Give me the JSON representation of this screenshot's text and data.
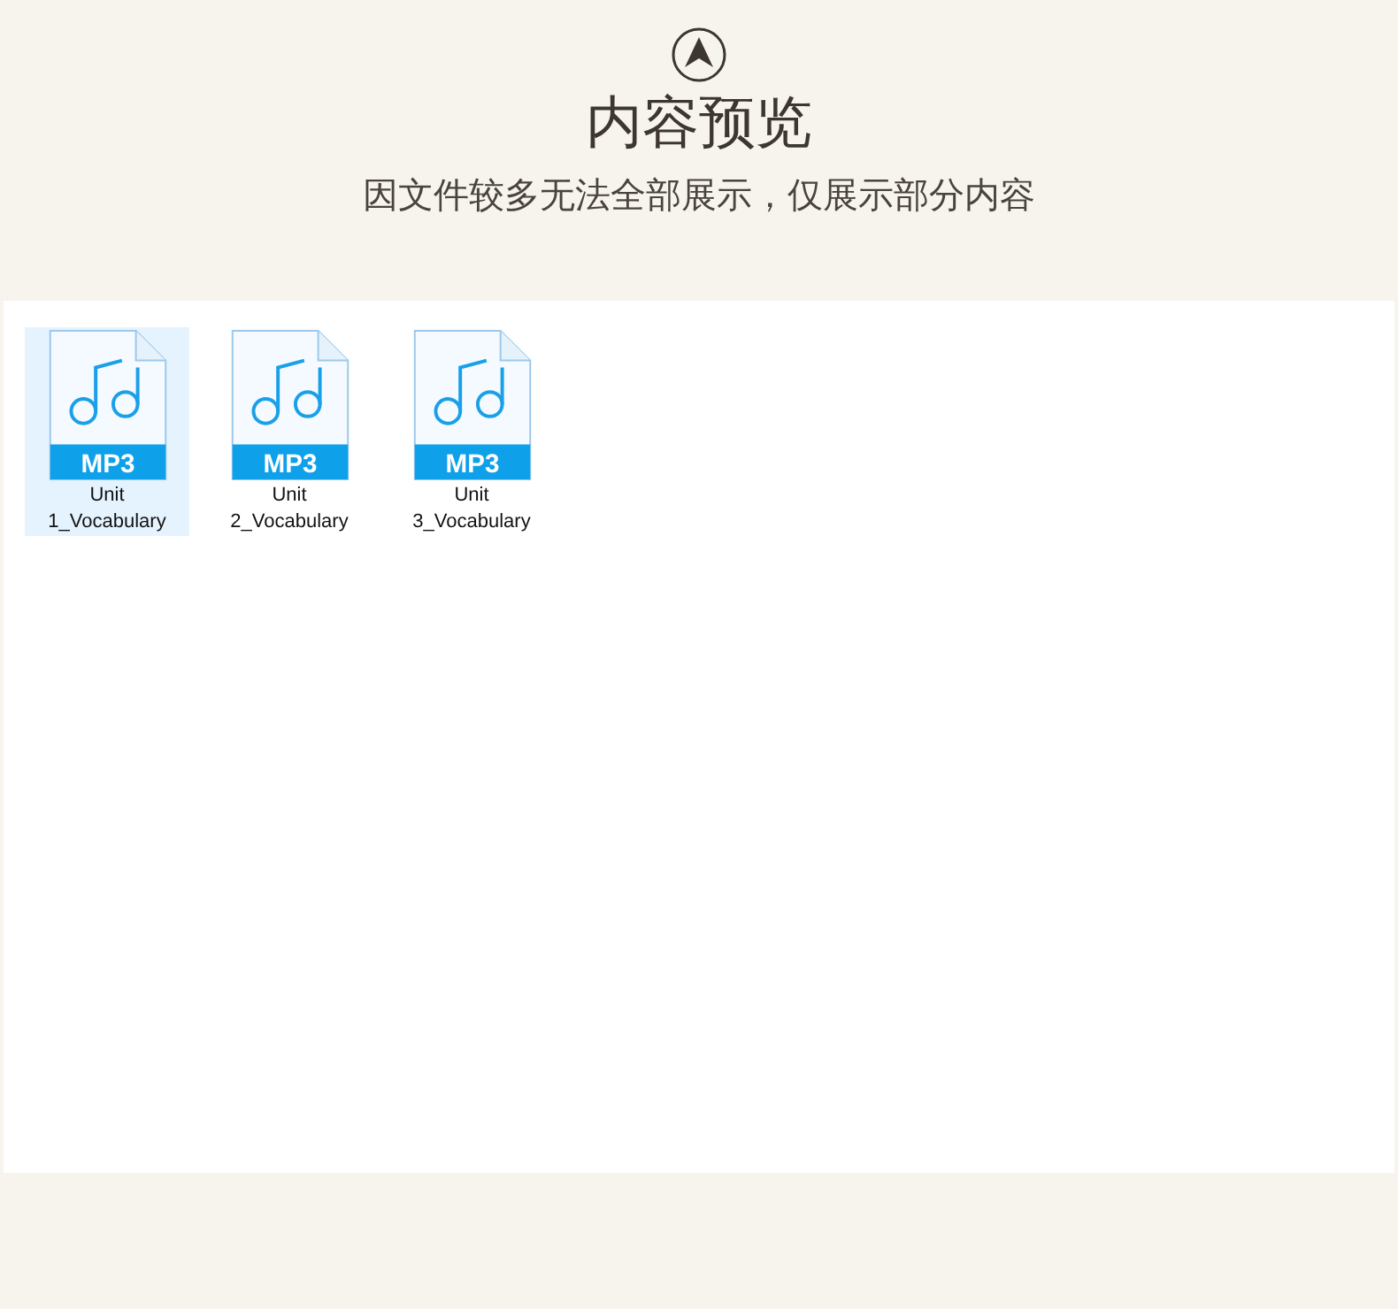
{
  "header": {
    "title": "内容预览",
    "subtitle": "因文件较多无法全部展示，仅展示部分内容"
  },
  "files": [
    {
      "name": "Unit 1_Vocabulary",
      "badge": "MP3",
      "selected": true
    },
    {
      "name": "Unit 2_Vocabulary",
      "badge": "MP3",
      "selected": false
    },
    {
      "name": "Unit 3_Vocabulary",
      "badge": "MP3",
      "selected": false
    }
  ]
}
